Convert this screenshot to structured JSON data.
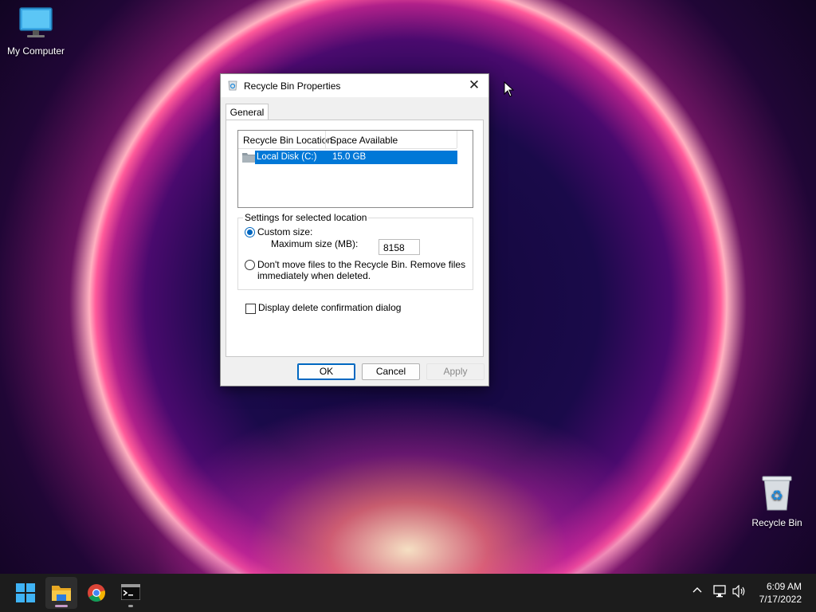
{
  "desktop": {
    "icons": [
      {
        "label": "My Computer"
      },
      {
        "label": "Recycle Bin"
      }
    ]
  },
  "dialog": {
    "title": "Recycle Bin Properties",
    "close_symbol": "✕",
    "tabs": [
      {
        "label": "General"
      }
    ],
    "list": {
      "columns": [
        "Recycle Bin Location",
        "Space Available"
      ],
      "rows": [
        {
          "location": "Local Disk (C:)",
          "space": "15.0 GB",
          "selected": true
        }
      ]
    },
    "settings": {
      "legend": "Settings for selected location",
      "custom_size_label": "Custom size:",
      "max_size_label": "Maximum size (MB):",
      "max_size_value": "8158",
      "dont_move_line1": "Don't move files to the Recycle Bin. Remove files",
      "dont_move_line2": "immediately when deleted.",
      "selected_option": "custom-size"
    },
    "confirm_label": "Display delete confirmation dialog",
    "confirm_checked": false,
    "buttons": {
      "ok": "OK",
      "cancel": "Cancel",
      "apply": "Apply"
    }
  },
  "taskbar": {
    "apps": [
      {
        "name": "start-icon"
      },
      {
        "name": "file-explorer-icon",
        "active": true
      },
      {
        "name": "chrome-icon"
      },
      {
        "name": "terminal-icon"
      }
    ],
    "tray_icons": [
      "chevron-up-icon",
      "network-icon",
      "volume-icon"
    ],
    "time": "6:09 AM",
    "date": "7/17/2022"
  },
  "colors": {
    "selection": "#0078d7",
    "accent": "#0067c0",
    "taskbar": "#1c1c1c"
  }
}
